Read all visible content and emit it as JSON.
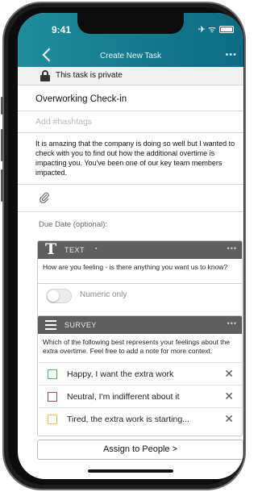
{
  "status": {
    "time": "9:41",
    "icons": "✈ ᯤ"
  },
  "nav": {
    "title": "Create New Task",
    "more": "•••"
  },
  "privacy": {
    "text": "This task is private"
  },
  "task": {
    "title": "Overworking Check-in",
    "hashtag_placeholder": "Add #hashtags",
    "description": "It is amazing that the company is doing so well but I wanted to check with you to find out how the additional overtime is impacting you.  You've been one of our key team members impacted."
  },
  "due_date": {
    "label": "Due Date (optional):"
  },
  "text_card": {
    "type_label": "TEXT",
    "more": "•••",
    "question": "How are you feeling - is there anything you want us to know?",
    "toggle_label": "Numeric only",
    "toggle_on": false
  },
  "survey_card": {
    "type_label": "SURVEY",
    "more": "•••",
    "question": "Which of the following best represents your feelings about the extra overtime. Feel free to add a note for more context.",
    "options": [
      {
        "label": "Happy, I want the extra work",
        "color": "#5bb85b"
      },
      {
        "label": "Neutral, I'm indifferent about it",
        "color": "#a3456a"
      },
      {
        "label": "Tired, the extra work is starting...",
        "color": "#f0c060"
      }
    ],
    "remove_symbol": "✕"
  },
  "assign": {
    "label": "Assign to People >"
  }
}
